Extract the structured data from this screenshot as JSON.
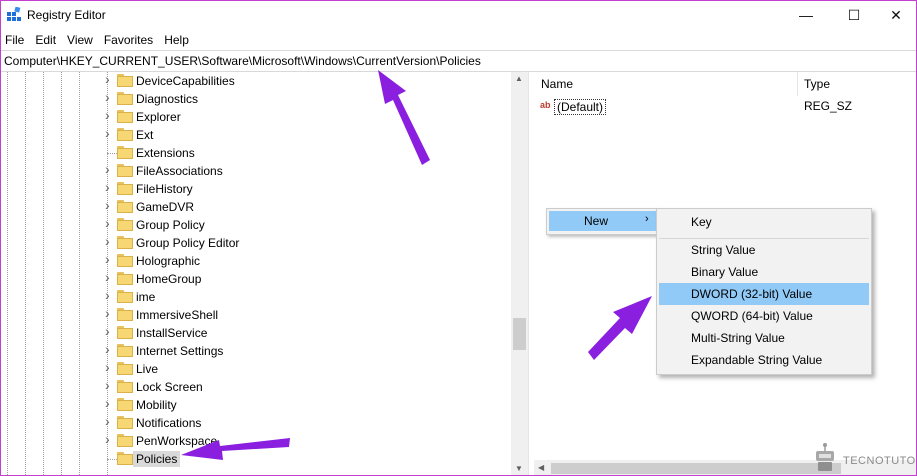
{
  "window": {
    "title": "Registry Editor",
    "minimize": "—",
    "maximize": "☐",
    "close": "✕"
  },
  "menu": [
    "File",
    "Edit",
    "View",
    "Favorites",
    "Help"
  ],
  "address": "Computer\\HKEY_CURRENT_USER\\Software\\Microsoft\\Windows\\CurrentVersion\\Policies",
  "tree": [
    {
      "label": "DeviceCapabilities",
      "expandable": true
    },
    {
      "label": "Diagnostics",
      "expandable": true
    },
    {
      "label": "Explorer",
      "expandable": true
    },
    {
      "label": "Ext",
      "expandable": true
    },
    {
      "label": "Extensions",
      "expandable": false
    },
    {
      "label": "FileAssociations",
      "expandable": true
    },
    {
      "label": "FileHistory",
      "expandable": true
    },
    {
      "label": "GameDVR",
      "expandable": true
    },
    {
      "label": "Group Policy",
      "expandable": true
    },
    {
      "label": "Group Policy Editor",
      "expandable": true
    },
    {
      "label": "Holographic",
      "expandable": true
    },
    {
      "label": "HomeGroup",
      "expandable": true
    },
    {
      "label": "ime",
      "expandable": true
    },
    {
      "label": "ImmersiveShell",
      "expandable": true
    },
    {
      "label": "InstallService",
      "expandable": true
    },
    {
      "label": "Internet Settings",
      "expandable": true
    },
    {
      "label": "Live",
      "expandable": true
    },
    {
      "label": "Lock Screen",
      "expandable": true
    },
    {
      "label": "Mobility",
      "expandable": true
    },
    {
      "label": "Notifications",
      "expandable": true
    },
    {
      "label": "PenWorkspace",
      "expandable": true
    },
    {
      "label": "Policies",
      "expandable": false,
      "selected": true
    }
  ],
  "list": {
    "columns": [
      "Name",
      "Type"
    ],
    "rows": [
      {
        "icon": "ab",
        "name": "(Default)",
        "type": "REG_SZ"
      }
    ]
  },
  "context_menu": {
    "new_label": "New",
    "arrow": "›",
    "submenu": [
      "Key",
      "String Value",
      "Binary Value",
      "DWORD (32-bit) Value",
      "QWORD (64-bit) Value",
      "Multi-String Value",
      "Expandable String Value"
    ],
    "highlighted": "DWORD (32-bit) Value"
  },
  "watermark": "TECNOTUTO",
  "colors": {
    "arrow": "#8a1fe0",
    "highlight": "#91c9f7",
    "frame": "#c43fd0"
  }
}
